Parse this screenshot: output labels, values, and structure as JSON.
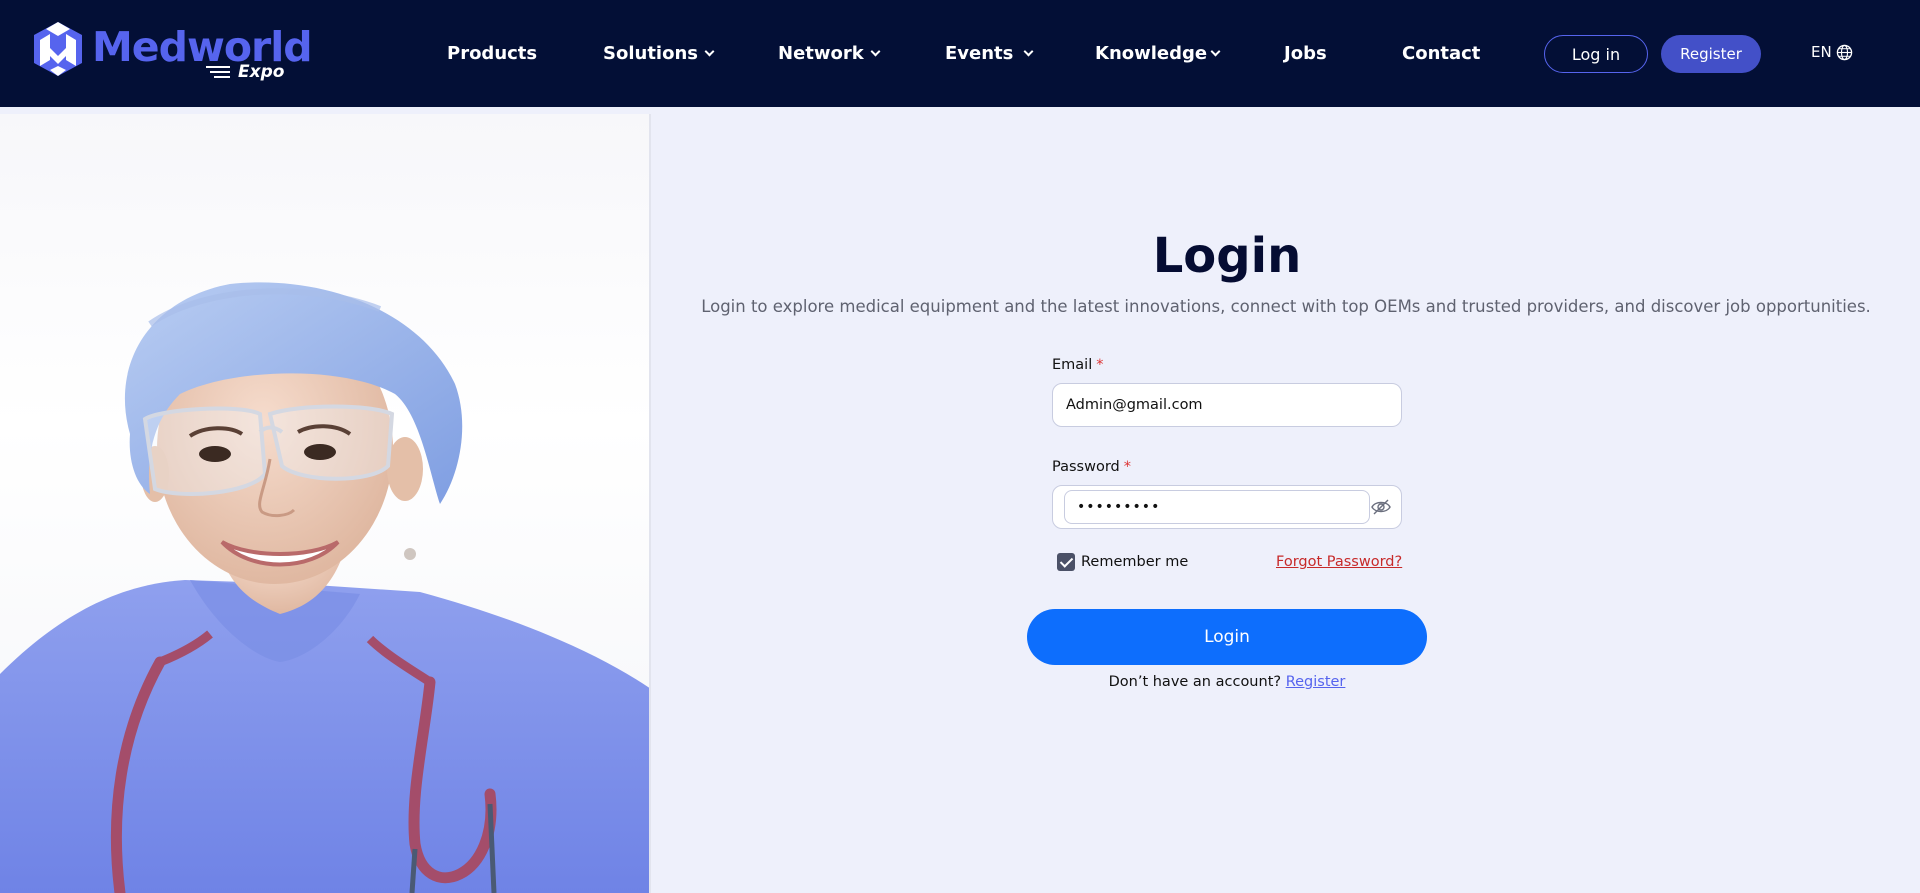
{
  "header": {
    "logo": {
      "name": "Medworld",
      "sub": "Expo",
      "icon": "medworld-logo-mark"
    },
    "nav": [
      {
        "label": "Products",
        "dropdown": false
      },
      {
        "label": "Solutions",
        "dropdown": true
      },
      {
        "label": "Network",
        "dropdown": true
      },
      {
        "label": "Events",
        "dropdown": true
      },
      {
        "label": "Knowledge",
        "dropdown": true
      },
      {
        "label": "Jobs",
        "dropdown": false
      },
      {
        "label": "Contact",
        "dropdown": false
      }
    ],
    "login_label": "Log in",
    "register_label": "Register",
    "language": "EN",
    "language_icon": "globe-icon"
  },
  "hero_image": {
    "subject": "smiling medical professional in scrubs with stethoscope"
  },
  "login": {
    "title": "Login",
    "subtitle": "Login to explore medical equipment and the latest innovations, connect with top OEMs and trusted providers, and discover job opportunities.",
    "email_label": "Email",
    "email_value": "Admin@gmail.com",
    "password_label": "Password",
    "password_value": "•••••••••",
    "required_mark": "*",
    "remember_label": "Remember me",
    "remember_checked": true,
    "forgot_label": "Forgot Password?",
    "submit_label": "Login",
    "signup_prompt": "Don’t have an account?",
    "signup_link": "Register"
  },
  "colors": {
    "header_bg": "#030f36",
    "brand": "#5664ee",
    "primary_button": "#0d6efd",
    "page_bg": "#eef0fb",
    "forgot_link": "#c72a2a"
  }
}
